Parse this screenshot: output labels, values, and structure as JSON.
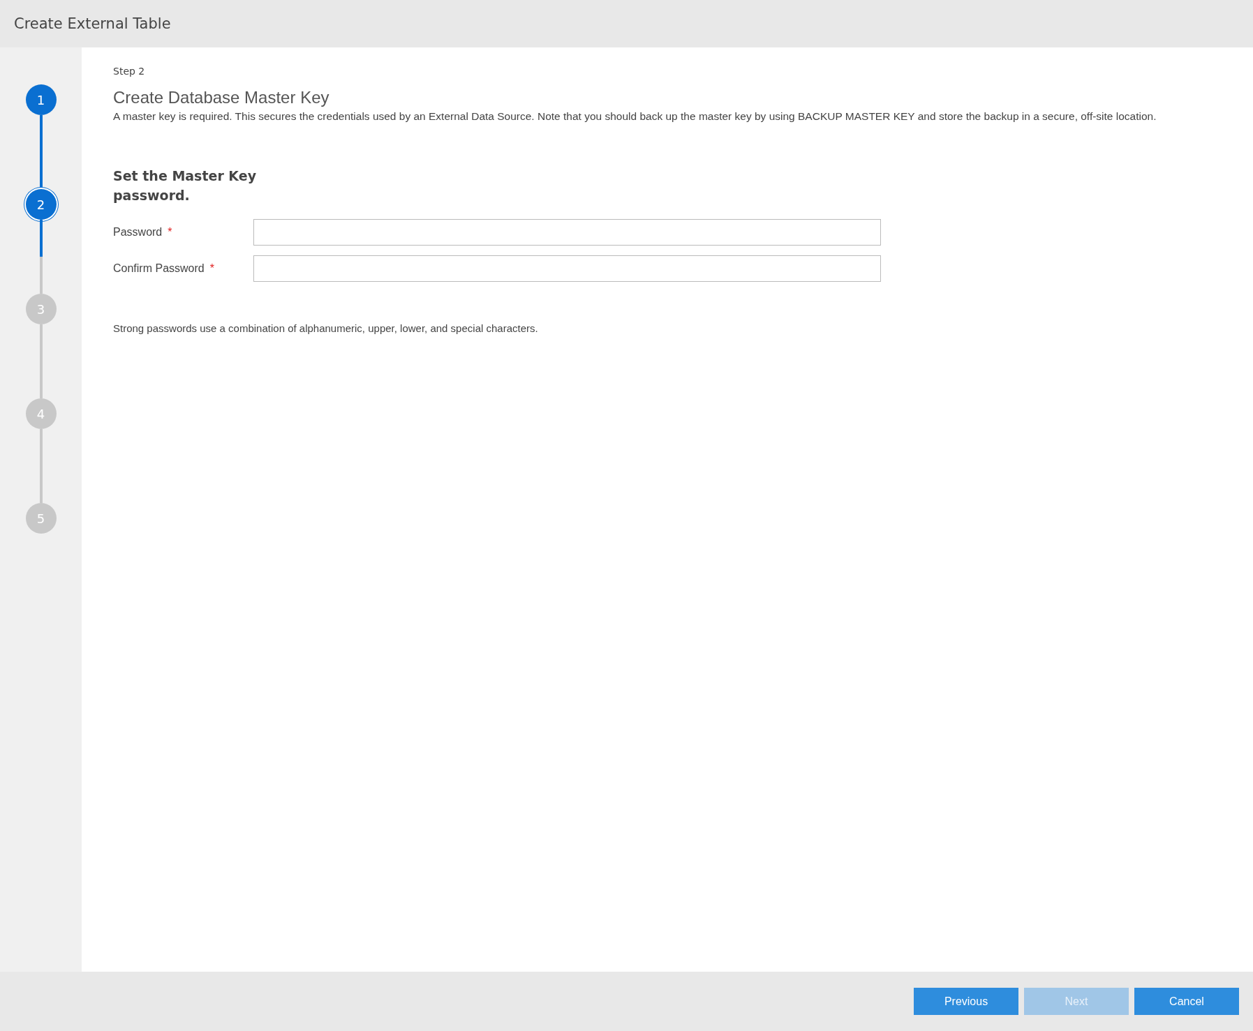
{
  "window": {
    "title": "Create External Table"
  },
  "steps": [
    {
      "number": "1",
      "completed": true,
      "selected": false
    },
    {
      "number": "2",
      "completed": false,
      "selected": true
    },
    {
      "number": "3",
      "completed": false,
      "selected": false
    },
    {
      "number": "4",
      "completed": false,
      "selected": false
    },
    {
      "number": "5",
      "completed": false,
      "selected": false
    }
  ],
  "content": {
    "step_label": "Step 2",
    "title": "Create Database Master Key",
    "description": "A master key is required. This secures the credentials used by an External Data Source. Note that you should back up the master key by using BACKUP MASTER KEY and store the backup in a secure, off-site location.",
    "section_heading": "Set the Master Key password.",
    "fields": [
      {
        "label": "Password",
        "required_mark": "*"
      },
      {
        "label": "Confirm Password",
        "required_mark": "*"
      }
    ],
    "hint": "Strong passwords use a combination of alphanumeric, upper, lower, and special characters."
  },
  "buttons": [
    {
      "label": "Previous",
      "disabled": false
    },
    {
      "label": "Next",
      "disabled": true
    },
    {
      "label": "Cancel",
      "disabled": false
    }
  ]
}
